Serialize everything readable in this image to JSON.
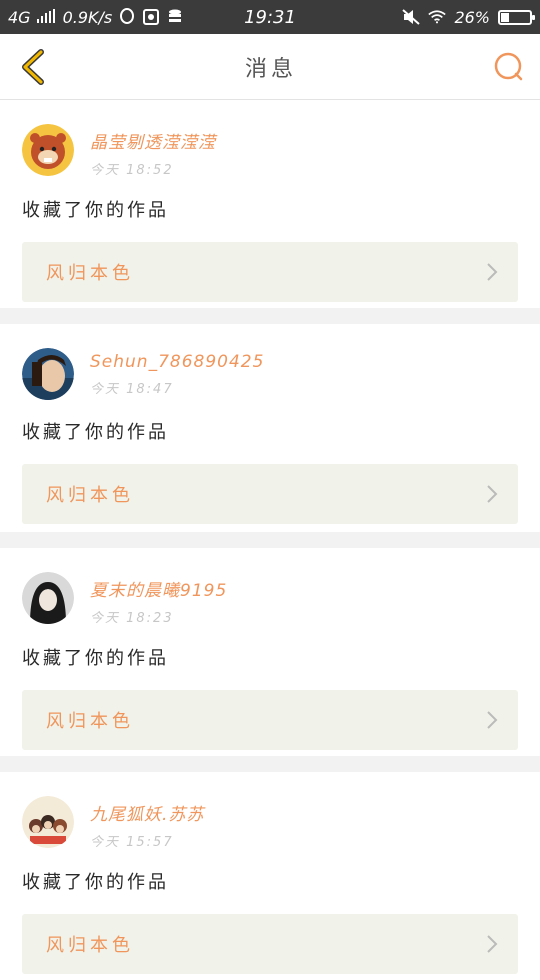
{
  "status_bar": {
    "network": "4G",
    "speed": "0.9K/s",
    "time": "19:31",
    "battery": "26%",
    "battery_level": 0.26
  },
  "header": {
    "title": "消息",
    "back_icon": "chevron-left-icon",
    "search_icon": "search-icon"
  },
  "notifications": [
    {
      "user": "晶莹剔透滢滢滢",
      "time": "今天 18:52",
      "action": "收藏了你的作品",
      "work_title": "风归本色",
      "avatar": "cartoon-beaver"
    },
    {
      "user": "Sehun_786890425",
      "time": "今天 18:47",
      "action": "收藏了你的作品",
      "work_title": "风归本色",
      "avatar": "young-man-photo"
    },
    {
      "user": "夏末的晨曦9195",
      "time": "今天 18:23",
      "action": "收藏了你的作品",
      "work_title": "风归本色",
      "avatar": "girl-dark-hair"
    },
    {
      "user": "九尾狐妖.苏苏",
      "time": "今天 15:57",
      "action": "收藏了你的作品",
      "work_title": "风归本色",
      "avatar": "group-photo"
    }
  ],
  "colors": {
    "accent": "#f0965c",
    "back_arrow": "#f2b800",
    "card_bg": "#f1f3ea"
  }
}
